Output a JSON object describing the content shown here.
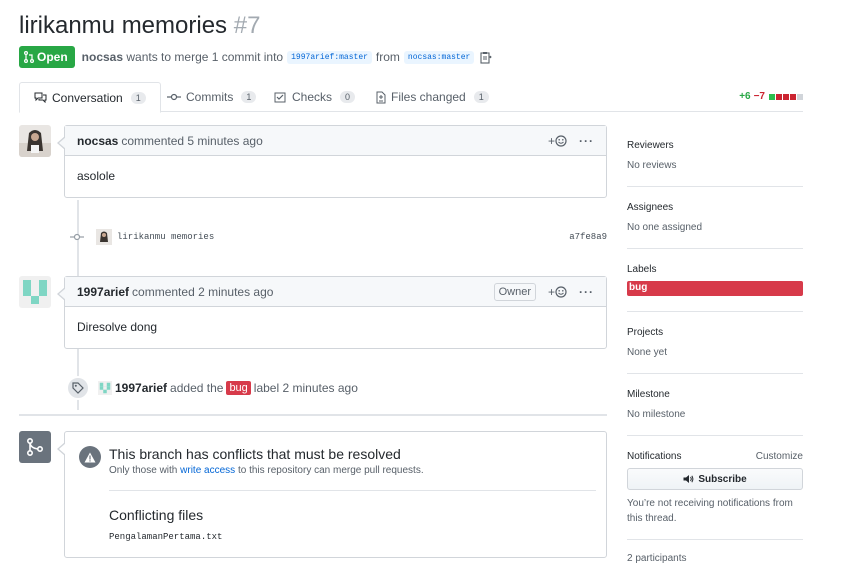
{
  "pr": {
    "title": "lirikanmu memories",
    "number": "#7",
    "state": "Open",
    "author": "nocsas",
    "merge_text": "wants to merge 1 commit into",
    "base_branch": "1997arief:master",
    "from_text": "from",
    "head_branch": "nocsas:master"
  },
  "tabs": [
    {
      "label": "Conversation",
      "count": "1",
      "icon": "comment-discussion-icon"
    },
    {
      "label": "Commits",
      "count": "1",
      "icon": "git-commit-icon"
    },
    {
      "label": "Checks",
      "count": "0",
      "icon": "checklist-icon"
    },
    {
      "label": "Files changed",
      "count": "1",
      "icon": "file-diff-icon"
    }
  ],
  "diffstat": {
    "additions": "+6",
    "deletions": "−7"
  },
  "comments": [
    {
      "author": "nocsas",
      "action": "commented 5 minutes ago",
      "body": "asolole",
      "role": ""
    },
    {
      "author": "1997arief",
      "action": "commented 2 minutes ago",
      "body": "Diresolve dong",
      "role": "Owner"
    }
  ],
  "commit": {
    "message": "lirikanmu memories",
    "sha": "a7fe8a9"
  },
  "label_event": {
    "actor": "1997arief",
    "prefix": "added the",
    "label": "bug",
    "suffix": "label 2 minutes ago"
  },
  "merge": {
    "title": "This branch has conflicts that must be resolved",
    "sub_prefix": "Only those with",
    "sub_link": "write access",
    "sub_suffix": "to this repository can merge pull requests.",
    "files_title": "Conflicting files",
    "file": "PengalamanPertama.txt"
  },
  "sidebar": {
    "reviewers": {
      "title": "Reviewers",
      "value": "No reviews"
    },
    "assignees": {
      "title": "Assignees",
      "value": "No one assigned"
    },
    "labels": {
      "title": "Labels",
      "value": "bug"
    },
    "projects": {
      "title": "Projects",
      "value": "None yet"
    },
    "milestone": {
      "title": "Milestone",
      "value": "No milestone"
    },
    "notifications": {
      "title": "Notifications",
      "customize": "Customize",
      "button": "Subscribe",
      "note": "You’re not receiving notifications from this thread."
    },
    "participants": "2 participants"
  },
  "colors": {
    "open": "#28a745",
    "bug": "#d73a4a",
    "link": "#0366d6",
    "add": "#28a745",
    "del": "#cb2431"
  }
}
